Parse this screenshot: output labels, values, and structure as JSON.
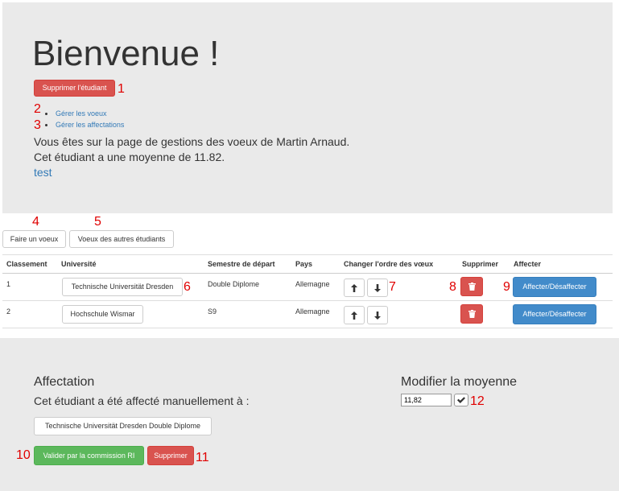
{
  "header": {
    "title": "Bienvenue !",
    "delete_student_label": "Supprimer l'étudiant",
    "links": [
      "Gérer les voeux",
      "Gérer les affectations"
    ],
    "info_line1": "Vous êtes sur la page de gestions des voeux de Martin Arnaud.",
    "info_line2": "Cet étudiant a une moyenne de 11.82.",
    "test_link": "test"
  },
  "toolbar": {
    "make_wish_label": "Faire un voeux",
    "other_wishes_label": "Voeux des autres étudiants"
  },
  "table": {
    "columns": [
      "Classement",
      "Université",
      "Semestre de départ",
      "Pays",
      "Changer l'ordre des vœux",
      "Supprimer",
      "Affecter"
    ],
    "rows": [
      {
        "rank": "1",
        "university": "Technische Universität Dresden",
        "semester": "Double Diplome",
        "country": "Allemagne",
        "assign_label": "Affecter/Désaffecter"
      },
      {
        "rank": "2",
        "university": "Hochschule Wismar",
        "semester": "S9",
        "country": "Allemagne",
        "assign_label": "Affecter/Désaffecter"
      }
    ]
  },
  "affectation": {
    "title": "Affectation",
    "text": "Cet étudiant a été affecté manuellement à :",
    "assigned_label": "Technische Universität Dresden Double Diplome",
    "validate_label": "Valider par la commission RI",
    "delete_label": "Supprimer"
  },
  "average": {
    "title": "Modifier la moyenne",
    "value": "11,82"
  },
  "annotations": [
    "1",
    "2",
    "3",
    "4",
    "5",
    "6",
    "7",
    "8",
    "9",
    "10",
    "11",
    "12"
  ],
  "icons": {
    "up": "arrow-up-icon",
    "down": "arrow-down-icon",
    "trash": "trash-icon",
    "check": "check-icon"
  },
  "colors": {
    "danger": "#d9534f",
    "primary": "#428bca",
    "success": "#5cb85c",
    "link": "#337ab7",
    "annotation": "#e00000"
  }
}
